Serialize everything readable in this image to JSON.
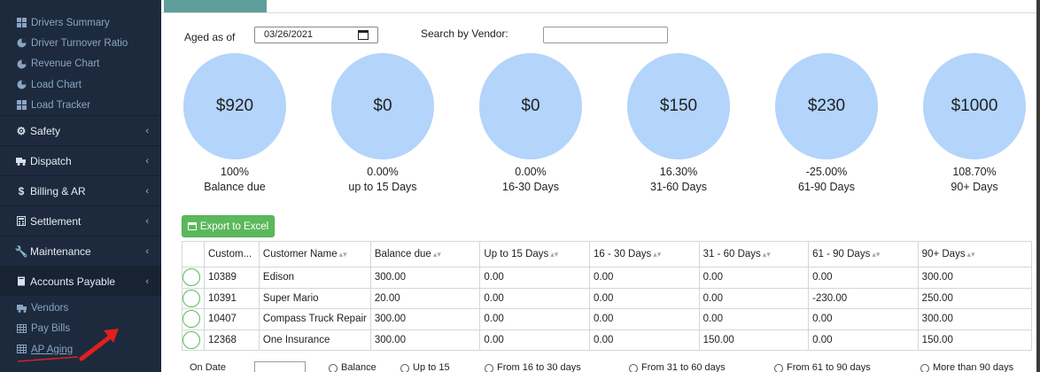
{
  "sidebar": {
    "sub_top": [
      {
        "label": "Drivers Summary",
        "icon": "grid-icon"
      },
      {
        "label": "Driver Turnover Ratio",
        "icon": "pie-icon"
      },
      {
        "label": "Revenue Chart",
        "icon": "pie-icon"
      },
      {
        "label": "Load Chart",
        "icon": "pie-icon"
      },
      {
        "label": "Load Tracker",
        "icon": "grid-icon"
      }
    ],
    "sections": [
      {
        "label": "Safety",
        "icon": "gears-icon"
      },
      {
        "label": "Dispatch",
        "icon": "truck-icon"
      },
      {
        "label": "Billing & AR",
        "icon": "dollar-icon"
      },
      {
        "label": "Settlement",
        "icon": "calculator-icon"
      },
      {
        "label": "Maintenance",
        "icon": "wrench-icon"
      },
      {
        "label": "Accounts Payable",
        "icon": "book-icon"
      }
    ],
    "ap_sub": [
      {
        "label": "Vendors",
        "icon": "truck-icon"
      },
      {
        "label": "Pay Bills",
        "icon": "table-icon"
      },
      {
        "label": "AP Aging",
        "icon": "table-icon"
      }
    ]
  },
  "filters": {
    "aged_label": "Aged as of",
    "aged_value": "03/26/2021",
    "vendor_label": "Search by Vendor:",
    "vendor_value": ""
  },
  "aging": [
    {
      "amount": "$920",
      "percent": "100%",
      "label": "Balance due"
    },
    {
      "amount": "$0",
      "percent": "0.00%",
      "label": "up to 15 Days"
    },
    {
      "amount": "$0",
      "percent": "0.00%",
      "label": "16-30 Days"
    },
    {
      "amount": "$150",
      "percent": "16.30%",
      "label": "31-60 Days"
    },
    {
      "amount": "$230",
      "percent": "-25.00%",
      "label": "61-90 Days"
    },
    {
      "amount": "$1000",
      "percent": "108.70%",
      "label": "90+ Days"
    }
  ],
  "export_label": "Export to Excel",
  "table": {
    "columns": [
      "Custom...",
      "Customer Name",
      "Balance due",
      "Up to 15 Days",
      "16 - 30 Days",
      "31 - 60 Days",
      "61 - 90 Days",
      "90+ Days"
    ],
    "rows": [
      [
        "10389",
        "Edison",
        "300.00",
        "0.00",
        "0.00",
        "0.00",
        "0.00",
        "300.00"
      ],
      [
        "10391",
        "Super Mario",
        "20.00",
        "0.00",
        "0.00",
        "0.00",
        "-230.00",
        "250.00"
      ],
      [
        "10407",
        "Compass Truck Repair",
        "300.00",
        "0.00",
        "0.00",
        "0.00",
        "0.00",
        "300.00"
      ],
      [
        "12368",
        "One Insurance",
        "300.00",
        "0.00",
        "0.00",
        "150.00",
        "0.00",
        "150.00"
      ]
    ]
  },
  "bottom": {
    "on_date": "On Date",
    "options": [
      "Balance",
      "Up to 15",
      "From 16 to 30 days",
      "From 31 to 60 days",
      "From 61 to 90 days",
      "More than 90 days"
    ]
  },
  "colors": {
    "sidebar_bg": "#1d2a3d",
    "circle_fill": "#b3d4fb",
    "export_green": "#5cb85c",
    "tab_teal": "#5f9e9a"
  }
}
